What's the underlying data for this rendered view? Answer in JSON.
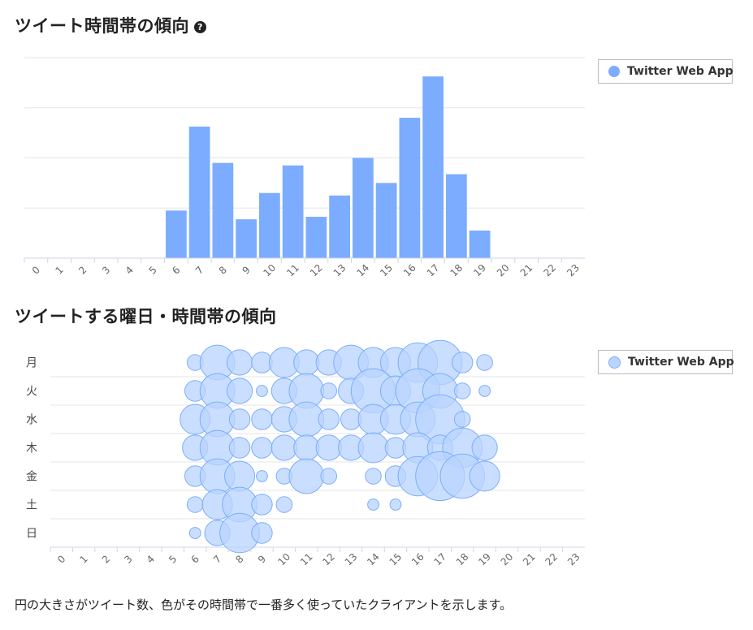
{
  "section1": {
    "title": "ツイート時間帯の傾向",
    "help_icon": "question-circle-icon"
  },
  "section2": {
    "title": "ツイートする曜日・時間帯の傾向"
  },
  "legend1": {
    "label": "Twitter Web App"
  },
  "legend2": {
    "label": "Twitter Web App"
  },
  "caption": "円の大きさがツイート数、色がその時間帯で一番多く使っていたクライアントを示します。",
  "colors": {
    "bar": "#7cacff",
    "bubble_fill": "#b8d4ff",
    "bubble_stroke": "#7cacff",
    "grid": "#e6e6e6",
    "axis": "#ccd6eb"
  },
  "chart_data": [
    {
      "type": "bar",
      "categories": [
        "0",
        "1",
        "2",
        "3",
        "4",
        "5",
        "6",
        "7",
        "8",
        "9",
        "10",
        "11",
        "12",
        "13",
        "14",
        "15",
        "16",
        "17",
        "18",
        "19",
        "20",
        "21",
        "22",
        "23"
      ],
      "series": [
        {
          "name": "Twitter Web App",
          "values": [
            0,
            0,
            0,
            0,
            0,
            0,
            19,
            52.5,
            38,
            15.5,
            26,
            37,
            16.5,
            25,
            40,
            30,
            56,
            72.5,
            33.5,
            11,
            0,
            0,
            0,
            0
          ]
        }
      ],
      "ylim": [
        0,
        80
      ],
      "grid": true,
      "legend": "top-right"
    },
    {
      "type": "scatter",
      "subtype": "bubble",
      "x_categories": [
        "0",
        "1",
        "2",
        "3",
        "4",
        "5",
        "6",
        "7",
        "8",
        "9",
        "10",
        "11",
        "12",
        "13",
        "14",
        "15",
        "16",
        "17",
        "18",
        "19",
        "20",
        "21",
        "22",
        "23"
      ],
      "y_categories": [
        "月",
        "火",
        "水",
        "木",
        "金",
        "土",
        "日"
      ],
      "series": [
        {
          "name": "Twitter Web App",
          "values": [
            [
              0,
              0,
              0,
              0,
              0,
              0,
              2,
              6,
              4,
              3,
              5,
              4,
              4,
              6,
              5,
              5,
              7,
              8,
              3,
              2,
              0,
              0,
              0,
              0
            ],
            [
              0,
              0,
              0,
              0,
              0,
              0,
              3,
              6,
              4,
              1,
              4,
              6,
              2,
              4,
              8,
              5,
              8,
              6,
              2,
              1,
              0,
              0,
              0,
              0
            ],
            [
              0,
              0,
              0,
              0,
              0,
              0,
              5,
              6,
              3,
              3,
              4,
              6,
              3,
              3,
              5,
              5,
              6,
              9,
              2,
              0,
              0,
              0,
              0,
              0
            ],
            [
              0,
              0,
              0,
              0,
              0,
              0,
              4,
              6,
              3,
              3,
              4,
              4,
              4,
              4,
              5,
              3,
              5,
              4,
              7,
              4,
              0,
              0,
              0,
              0
            ],
            [
              0,
              0,
              0,
              0,
              0,
              0,
              3,
              6,
              5,
              1,
              2,
              6,
              2,
              0,
              2,
              3,
              7,
              9,
              8,
              5,
              0,
              0,
              0,
              0
            ],
            [
              0,
              0,
              0,
              0,
              0,
              0,
              2,
              5,
              6,
              3,
              2,
              0,
              0,
              0,
              1,
              1,
              0,
              0,
              0,
              0,
              0,
              0,
              0,
              0
            ],
            [
              0,
              0,
              0,
              0,
              0,
              0,
              1,
              4,
              7,
              3,
              0,
              0,
              0,
              0,
              0,
              0,
              0,
              0,
              0,
              0,
              0,
              0,
              0,
              0
            ]
          ]
        }
      ],
      "grid": true,
      "legend": "top-right"
    }
  ]
}
